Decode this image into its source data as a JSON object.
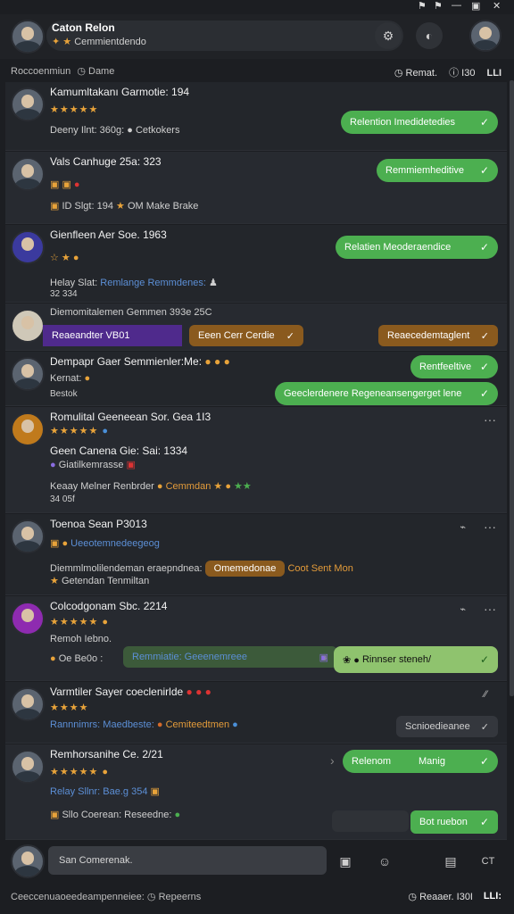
{
  "header": {
    "title": "Caton Relon",
    "subtitle": "Cemmientdendo",
    "star_icons": "✦ ★"
  },
  "subbar": {
    "left": "Roccoenmiun",
    "left_icon": "Dame",
    "right1": "Remat.",
    "right2": "I30",
    "right3": "LLI"
  },
  "cards": [
    {
      "name": "Kamumltakanı Garmotie: 194",
      "stars": "★★★★★",
      "meta": "Deeny  Ilnt:  360g:",
      "meta2": "Cetkokers",
      "button": "Relention Imedidetedies"
    },
    {
      "name": "Vals Canhuge  25a:  323",
      "meta": "ID   Slgt:  194",
      "meta2": "OM  Make  Brake",
      "button": "Remmiemheditive"
    },
    {
      "name": "Gienfleen Aer  Soe.  1963",
      "meta": "Helay   Slat:",
      "link": "Remlange   Remmdenes:",
      "button": "Relatien Meoderaendice",
      "extra": "32  334"
    },
    {
      "name": "Diemomitalemen Gemmen  393e  25C",
      "tag": "Reaeandter VB01",
      "brown1": "Eeen Cerr Cerdie",
      "brown2": "Reaecedemtaglent"
    },
    {
      "name": "Dempapr Gaer  Semmienler:Me:",
      "meta": "Kernat:",
      "meta2": "Bestok",
      "button": "Rentfeeltive",
      "button2": "Geeclerdenere Regeneansengerget lene"
    },
    {
      "name": "Romulital Geeneean  Sor.  Gea  1I3",
      "stars": "★★★★★",
      "name2": "Geen Canena  Gie:  Sai:  1334",
      "sub2": "Giatilkemrasse",
      "meta": "Keaay   Melner  Renbrder",
      "link": "Cemmdan",
      "extra": "34 05f"
    },
    {
      "name": "Toenoa Sean  P3013",
      "link": "Ueeotemnedeegeog",
      "meta": "Diemmlmolilendeman  eraepndnea:",
      "brown": "Omemedonae",
      "meta2": "Coot  Sent",
      "meta3": "Mon",
      "extra": "Getendan  Tenmiltan"
    },
    {
      "name": "Colcodgonam  Sbc.  2214",
      "stars": "★★★★★",
      "meta": "Remoh  Iebno.",
      "meta2": "Oe  Be0o :",
      "link": "Remmiatie:   Geeenemreee",
      "greenbox": "Rinnser  steneh/"
    },
    {
      "name": "Varmtiler Sayer coeclenirlde",
      "stars": "★★★★",
      "link": "Rannnimrs:   Maedbeste:",
      "orange": "Cemiteedtmen",
      "grey": "Scnioedieanee"
    },
    {
      "name": "Remhorsanihe  Ce.  2/21",
      "stars": "★★★★★",
      "meta": "Relay   Sllnr:   Bae.g   354",
      "meta2": "Sllo   Coerean:  Reseedne:",
      "button": "Relenom",
      "button_right": "Manig",
      "button2": "Bot ruebon"
    }
  ],
  "bottom": {
    "input": "San  Comerenak.",
    "footer_left": "Ceeccenuaoeedeampenneiee:",
    "footer_icon": "Repeerns",
    "footer_right": "Reaaer.    I30I",
    "footer_bold": "LLI:"
  },
  "colors": {
    "green": "#4caf50",
    "brown": "#8a5a1e",
    "purple": "#4f2a8c",
    "link": "#5c8fd6"
  }
}
